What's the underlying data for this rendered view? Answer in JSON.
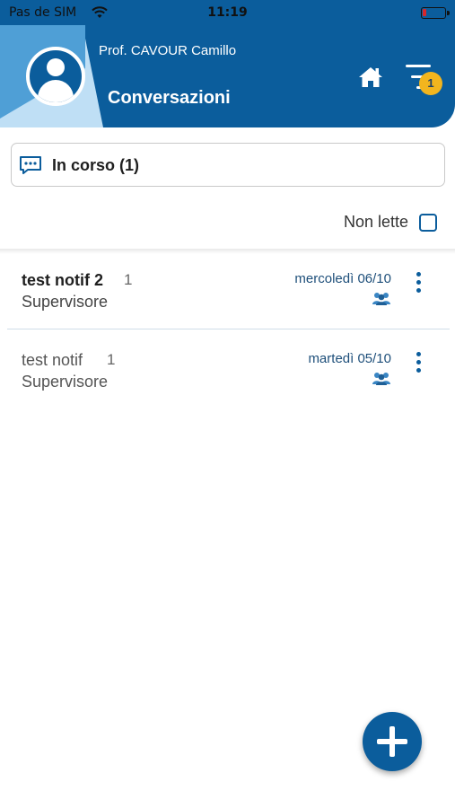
{
  "status_bar": {
    "carrier": "Pas de SIM",
    "time": "11:19"
  },
  "header": {
    "user_name": "Prof. CAVOUR Camillo",
    "title": "Conversazioni",
    "badge_count": "1"
  },
  "filter": {
    "label": "In corso (1)"
  },
  "unread_filter": {
    "label": "Non lette",
    "checked": false
  },
  "conversations": [
    {
      "subject": "test notif 2",
      "count": "1",
      "role": "Supervisore",
      "date": "mercoledì 06/10",
      "unread": true
    },
    {
      "subject": "test notif",
      "count": "1",
      "role": "Supervisore",
      "date": "martedì 05/10",
      "unread": false
    }
  ],
  "colors": {
    "primary": "#0b5d9c",
    "badge": "#f2b51e",
    "light_blue": "#bfdff5"
  },
  "icons": [
    "wifi-icon",
    "battery-icon",
    "avatar-icon",
    "home-icon",
    "filter-menu-icon",
    "chat-icon",
    "group-icon",
    "more-vertical-icon",
    "plus-icon"
  ]
}
